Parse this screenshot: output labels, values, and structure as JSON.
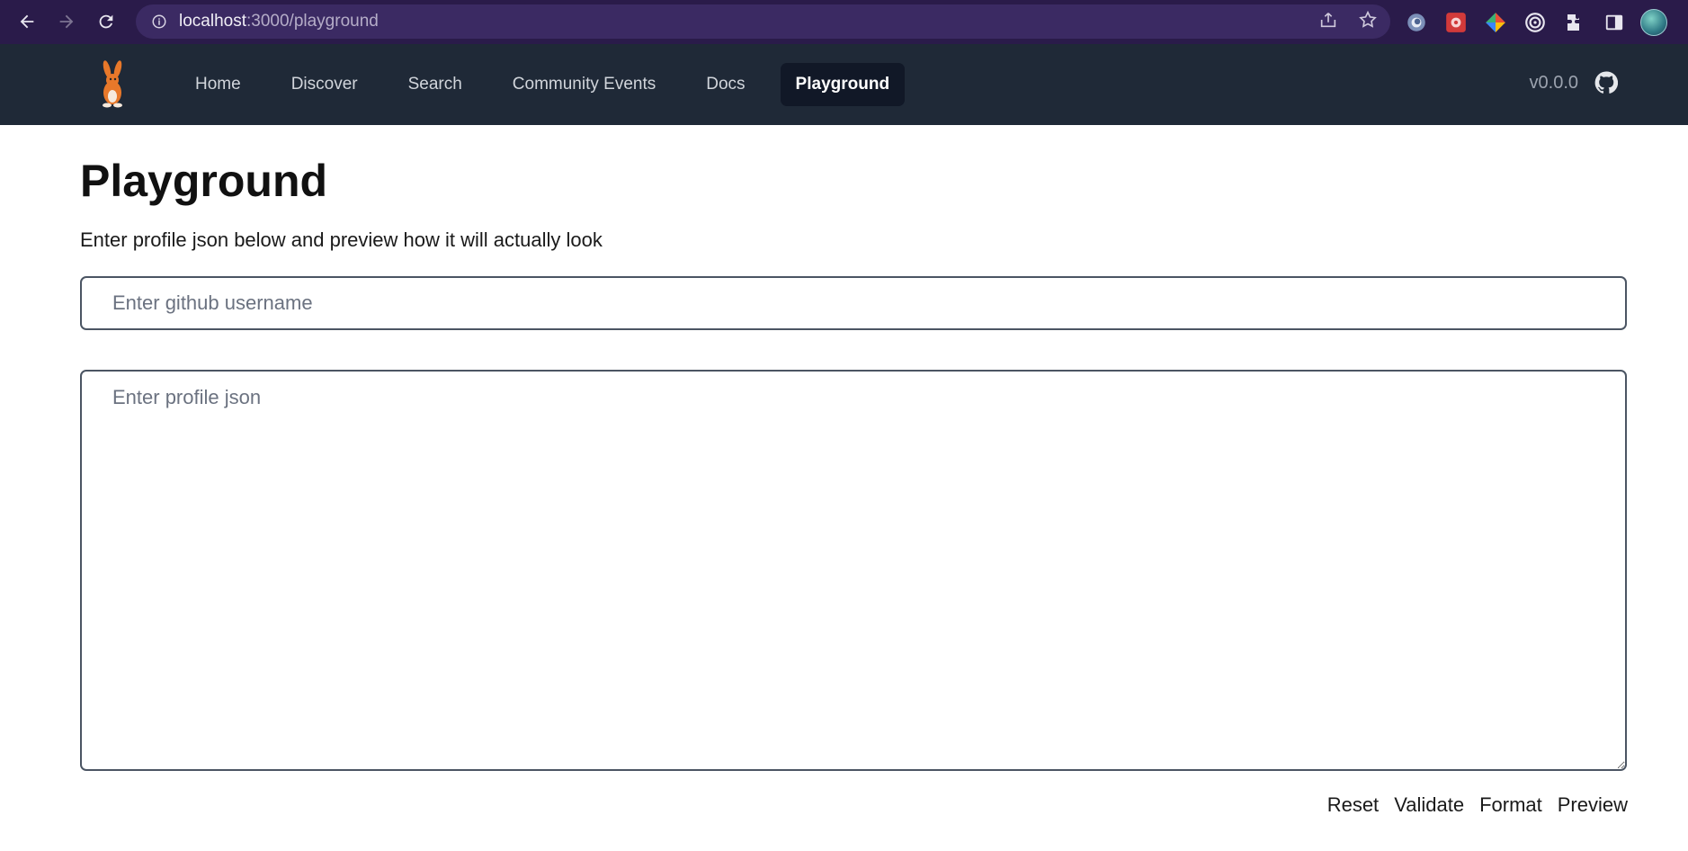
{
  "browser": {
    "url_host": "localhost",
    "url_path": ":3000/playground",
    "icons": [
      "back-arrow-icon",
      "forward-arrow-icon",
      "reload-icon",
      "info-icon",
      "share-icon",
      "star-icon",
      "extension-puzzle-icon",
      "sidebar-icon"
    ]
  },
  "navbar": {
    "links": [
      {
        "label": "Home",
        "active": false
      },
      {
        "label": "Discover",
        "active": false
      },
      {
        "label": "Search",
        "active": false
      },
      {
        "label": "Community Events",
        "active": false
      },
      {
        "label": "Docs",
        "active": false
      },
      {
        "label": "Playground",
        "active": true
      }
    ],
    "version": "v0.0.0",
    "colors": {
      "bg": "#1f2937",
      "active_bg": "#111827",
      "link": "#d1d5db"
    }
  },
  "main": {
    "title": "Playground",
    "subtitle": "Enter profile json below and preview how it will actually look",
    "username_placeholder": "Enter github username",
    "json_placeholder": "Enter profile json",
    "actions": {
      "reset": "Reset",
      "validate": "Validate",
      "format": "Format",
      "preview": "Preview"
    }
  }
}
